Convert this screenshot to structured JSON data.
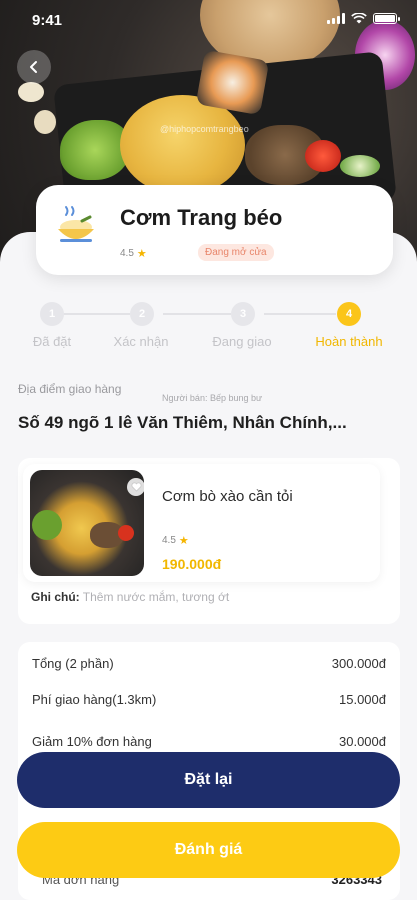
{
  "status_bar": {
    "time": "9:41"
  },
  "hero": {
    "watermark": "@hiphopcomtrangbeo"
  },
  "restaurant": {
    "name": "Cơm Trang béo",
    "rating": "4.5",
    "badge": "Đang mở cửa",
    "logo_icon": "rice-bowl-icon"
  },
  "stepper": {
    "steps": [
      {
        "number": "1",
        "label": "Đã đặt"
      },
      {
        "number": "2",
        "label": "Xác nhận"
      },
      {
        "number": "3",
        "label": "Đang giao"
      },
      {
        "number": "4",
        "label": "Hoàn thành"
      }
    ],
    "active_index": 3
  },
  "delivery": {
    "label": "Địa điểm giao hàng",
    "seller": "Người bán: Bếp bung bư",
    "address": "Số 49 ngõ 1 lê Văn Thiêm, Nhân Chính,..."
  },
  "item": {
    "name": "Cơm bò xào cần tỏi",
    "rating": "4.5",
    "price": "190.000đ",
    "note_label": "Ghi chú:",
    "note_text": "Thêm nước mắm, tương ớt"
  },
  "summary": {
    "rows": [
      {
        "label": "Tổng (2 phần)",
        "value": "300.000đ"
      },
      {
        "label": "Phí giao hàng(1.3km)",
        "value": "15.000đ"
      },
      {
        "label": "Giảm 10% đơn hàng",
        "value": "30.000đ"
      }
    ],
    "order_code_label": "Mã đơn hàng",
    "order_code_value": "3263343"
  },
  "buttons": {
    "reorder": "Đặt lại",
    "rate": "Đánh giá"
  },
  "colors": {
    "accent": "#fbc51a",
    "primary": "#1e2d6b",
    "price": "#f1b700"
  }
}
